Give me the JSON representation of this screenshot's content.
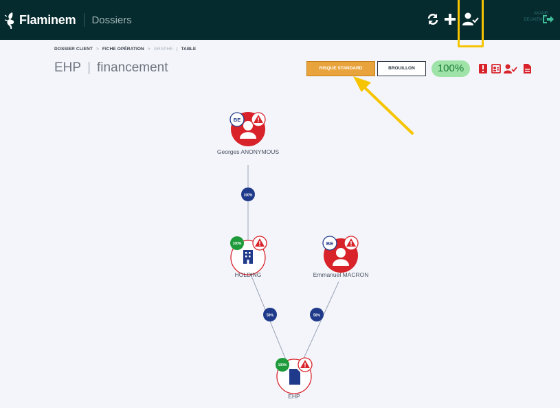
{
  "topbar": {
    "brand": "Flaminem",
    "section": "Dossiers",
    "icons": [
      "refresh-icon",
      "add-icon",
      "user-check-icon"
    ],
    "user_lines": [
      "AKAME",
      "DEUXIEMEN"
    ],
    "colors": {
      "bg": "#062b2e",
      "highlight": "#f6c400",
      "logout": "#3fbf9a"
    }
  },
  "breadcrumb": {
    "items": [
      "DOSSIER CLIENT",
      "FICHE OPÉRATION",
      "GRAPHE",
      "TABLE"
    ]
  },
  "title": {
    "main": "EHP",
    "sub": "financement"
  },
  "toolbar": {
    "risk_label": "RISQUE STANDARD",
    "draft_label": "BROUILLON",
    "percent": "100%",
    "icons": [
      "pdf-icon",
      "id-card-icon",
      "user-check-icon",
      "document-icon"
    ]
  },
  "graph": {
    "nodes": [
      {
        "label": "Georges ANONYMOUS",
        "type": "person",
        "badge": "BE",
        "alert": true
      },
      {
        "label": "HOLDING",
        "type": "company",
        "badge": "100%",
        "alert": true
      },
      {
        "label": "Emmanuel MACRON",
        "type": "person",
        "badge": "BE",
        "alert": true
      },
      {
        "label": "EHP",
        "type": "company",
        "badge": "100%",
        "alert": true
      }
    ],
    "edges": [
      {
        "from": "Georges ANONYMOUS",
        "to": "HOLDING",
        "label": "100%"
      },
      {
        "from": "HOLDING",
        "to": "EHP",
        "label": "50%"
      },
      {
        "from": "Emmanuel MACRON",
        "to": "EHP",
        "label": "50%"
      }
    ],
    "colors": {
      "person": "#d8232a",
      "edge_badge": "#1f3a8a",
      "pct_badge": "#1e9a3a",
      "company": "#1f3a8a"
    }
  }
}
